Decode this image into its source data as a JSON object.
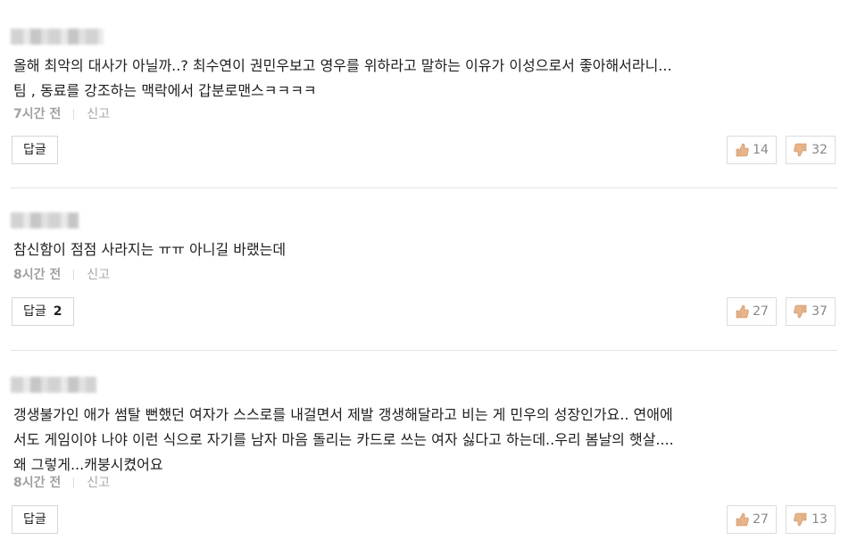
{
  "comments": [
    {
      "text": "올해 최악의 대사가 아닐까..? 최수연이 권민우보고 영우를 위하라고 말하는 이유가 이성으로서 좋아해서라니...\n팀 , 동료를 강조하는 맥락에서 갑분로맨스ㅋㅋㅋㅋ",
      "time": "7시간 전",
      "report": "신고",
      "reply_label": "답글",
      "reply_count": "",
      "likes": "14",
      "dislikes": "32"
    },
    {
      "text": "참신함이 점점 사라지는 ㅠㅠ 아니길 바랬는데",
      "time": "8시간 전",
      "report": "신고",
      "reply_label": "답글",
      "reply_count": "2",
      "likes": "27",
      "dislikes": "37"
    },
    {
      "text": "갱생불가인 애가 썸탈 뻔했던 여자가 스스로를 내걸면서 제발 갱생해달라고 비는 게 민우의 성장인가요.. 연애에\n서도 게임이야 나야 이런 식으로 자기를 남자 마음 돌리는 카드로 쓰는 여자 싫다고 하는데..우리 봄날의 햇살....\n왜 그렇게...캐붕시켰어요",
      "time": "8시간 전",
      "report": "신고",
      "reply_label": "답글",
      "reply_count": "",
      "likes": "27",
      "dislikes": "13"
    }
  ],
  "icons": {
    "like": "thumbs-up-icon",
    "dislike": "thumbs-down-icon"
  }
}
